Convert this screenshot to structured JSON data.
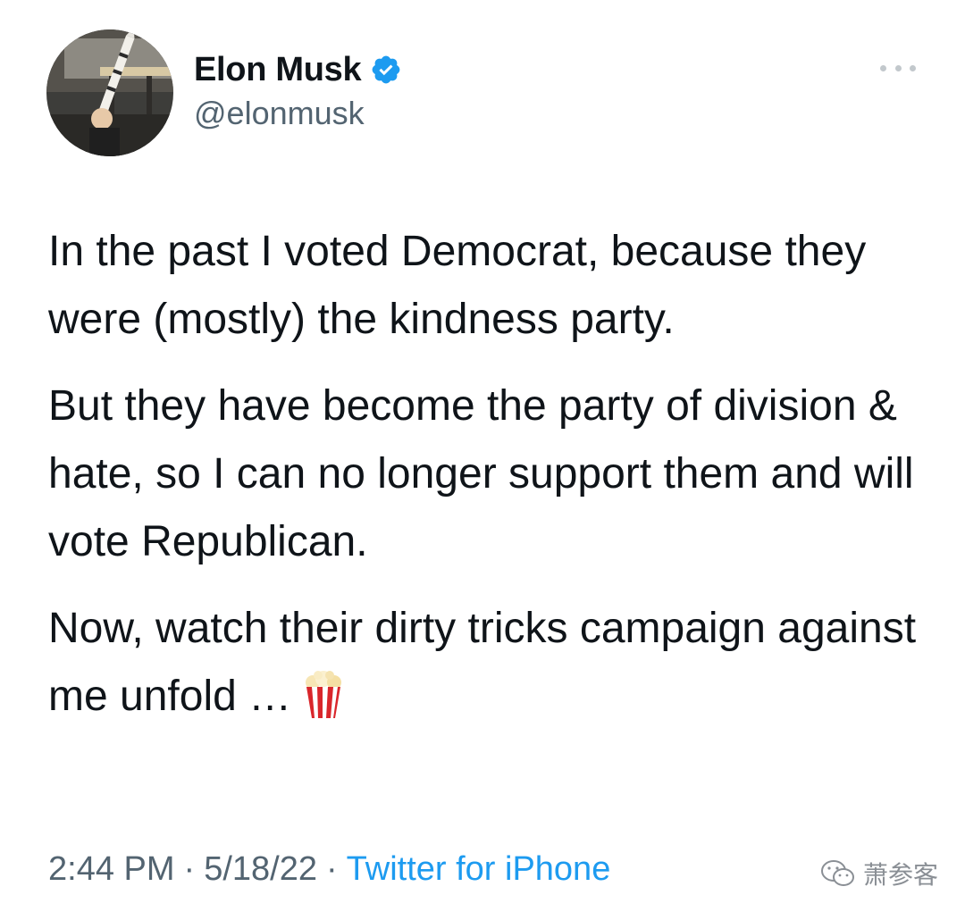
{
  "author": {
    "display_name": "Elon Musk",
    "handle": "@elonmusk",
    "verified": true,
    "verified_icon": "verified-badge-icon",
    "avatar_icon": "profile-photo"
  },
  "more_icon": "more-options-icon",
  "tweet": {
    "paragraphs": [
      "In the past I voted Democrat, because they were (mostly) the kindness party.",
      "But they have become the party of division & hate, so I can no longer support them and will vote Republican.",
      "Now, watch their dirty tricks campaign against me unfold …"
    ],
    "emoji": "popcorn"
  },
  "meta": {
    "time": "2:44 PM",
    "separator": "·",
    "date": "5/18/22",
    "source": "Twitter for iPhone"
  },
  "watermark": {
    "text": "萧参客",
    "icon": "wechat-icon"
  },
  "colors": {
    "text": "#0f1419",
    "secondary": "#536471",
    "link": "#1d9bf0",
    "verified": "#1d9bf0"
  }
}
